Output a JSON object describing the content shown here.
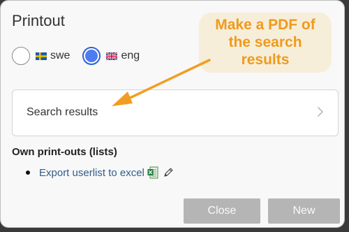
{
  "dialog": {
    "title": "Printout",
    "languages": [
      {
        "label": "swe",
        "flag": "sweden-flag-icon",
        "checked": false
      },
      {
        "label": "eng",
        "flag": "uk-flag-icon",
        "checked": true
      }
    ],
    "search_results_label": "Search results",
    "own_printouts_heading": "Own print-outs (lists)",
    "export_link_label": "Export userlist to excel",
    "close_label": "Close",
    "new_label": "New"
  },
  "annotation": {
    "text": "Make a PDF of\nthe search\nresults",
    "color": "#ef9a1e"
  },
  "icons": [
    "sweden-flag-icon",
    "uk-flag-icon",
    "chevron-right-icon",
    "excel-icon",
    "pencil-icon",
    "arrow-icon"
  ]
}
